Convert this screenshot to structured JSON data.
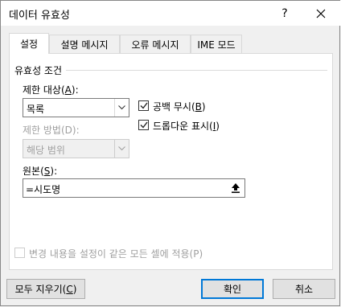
{
  "window": {
    "title": "데이터 유효성",
    "help_label": "?",
    "close_label": "✕"
  },
  "tabs": [
    {
      "label": "설정"
    },
    {
      "label": "설명 메시지"
    },
    {
      "label": "오류 메시지"
    },
    {
      "label": "IME 모드"
    }
  ],
  "settings": {
    "group_title": "유효성 조건",
    "allow_label_pre": "제한 대상(",
    "allow_label_key": "A",
    "allow_label_post": "):",
    "allow_value": "목록",
    "ignore_blank_pre": "공백 무시(",
    "ignore_blank_key": "B",
    "ignore_blank_post": ")",
    "ignore_blank_checked": true,
    "dropdown_pre": "드롭다운 표시(",
    "dropdown_key": "I",
    "dropdown_post": ")",
    "dropdown_checked": true,
    "data_label": "제한 방법(D):",
    "data_value": "해당 범위",
    "source_label_pre": "원본(",
    "source_label_key": "S",
    "source_label_post": "):",
    "source_value": "=시도명",
    "apply_all_label": "변경 내용을 설정이 같은 모든 셀에 적용(P)",
    "apply_all_checked": false
  },
  "footer": {
    "clear_all_pre": "모두 지우기(",
    "clear_all_key": "C",
    "clear_all_post": ")",
    "ok_label": "확인",
    "cancel_label": "취소"
  },
  "icons": {
    "dropdown": "chevron-down-icon",
    "range_picker": "collapse-dialog-icon",
    "check": "checkmark-icon"
  },
  "colors": {
    "accent": "#0078d7",
    "disabled_text": "#a0a0a0"
  }
}
